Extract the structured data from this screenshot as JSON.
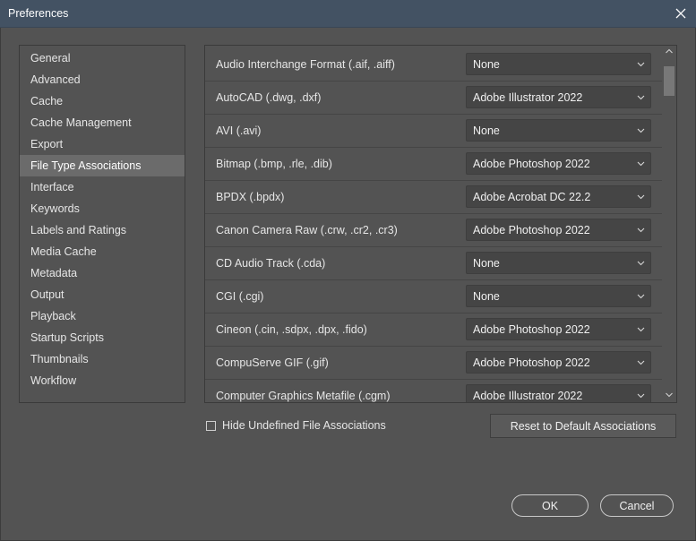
{
  "window": {
    "title": "Preferences"
  },
  "sidebar": {
    "items": [
      {
        "label": "General"
      },
      {
        "label": "Advanced"
      },
      {
        "label": "Cache"
      },
      {
        "label": "Cache Management"
      },
      {
        "label": "Export"
      },
      {
        "label": "File Type Associations",
        "selected": true
      },
      {
        "label": "Interface"
      },
      {
        "label": "Keywords"
      },
      {
        "label": "Labels and Ratings"
      },
      {
        "label": "Media Cache"
      },
      {
        "label": "Metadata"
      },
      {
        "label": "Output"
      },
      {
        "label": "Playback"
      },
      {
        "label": "Startup Scripts"
      },
      {
        "label": "Thumbnails"
      },
      {
        "label": "Workflow"
      }
    ]
  },
  "associations": [
    {
      "file_type": "Audio Interchange Format (.aif, .aiff)",
      "application": "None"
    },
    {
      "file_type": "AutoCAD (.dwg, .dxf)",
      "application": "Adobe Illustrator 2022"
    },
    {
      "file_type": "AVI (.avi)",
      "application": "None"
    },
    {
      "file_type": "Bitmap (.bmp, .rle, .dib)",
      "application": "Adobe Photoshop 2022"
    },
    {
      "file_type": "BPDX (.bpdx)",
      "application": "Adobe Acrobat DC 22.2"
    },
    {
      "file_type": "Canon Camera Raw (.crw, .cr2, .cr3)",
      "application": "Adobe Photoshop 2022"
    },
    {
      "file_type": "CD Audio Track (.cda)",
      "application": "None"
    },
    {
      "file_type": "CGI (.cgi)",
      "application": "None"
    },
    {
      "file_type": "Cineon (.cin, .sdpx, .dpx, .fido)",
      "application": "Adobe Photoshop 2022"
    },
    {
      "file_type": "CompuServe GIF (.gif)",
      "application": "Adobe Photoshop 2022"
    },
    {
      "file_type": "Computer Graphics Metafile (.cgm)",
      "application": "Adobe Illustrator 2022"
    }
  ],
  "footer": {
    "hide_undefined_label": "Hide Undefined File Associations",
    "hide_undefined_checked": false,
    "reset_label": "Reset to Default Associations",
    "ok_label": "OK",
    "cancel_label": "Cancel"
  },
  "colors": {
    "titlebar": "#435263",
    "background": "#535353",
    "selected_item": "#6b6b6b",
    "select_field": "#454545"
  }
}
